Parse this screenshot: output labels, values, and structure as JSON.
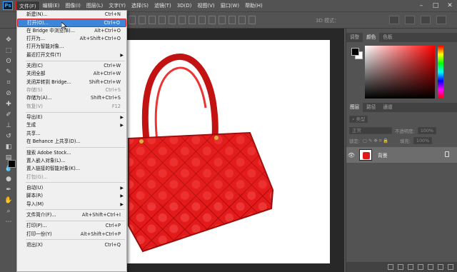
{
  "app": {
    "logo": "Ps"
  },
  "menubar": {
    "items": [
      "文件(F)",
      "编辑(E)",
      "图像(I)",
      "图层(L)",
      "文字(Y)",
      "选择(S)",
      "滤镜(T)",
      "3D(D)",
      "视图(V)",
      "窗口(W)",
      "帮助(H)"
    ],
    "active_index": 0
  },
  "options_bar": {
    "mode_label": "3D 模式："
  },
  "file_menu": {
    "groups": [
      [
        {
          "label": "新建(N)...",
          "shortcut": "Ctrl+N"
        },
        {
          "label": "打开(O)...",
          "shortcut": "Ctrl+O",
          "highlighted": true
        },
        {
          "label": "在 Bridge 中浏览(B)...",
          "shortcut": "Alt+Ctrl+O"
        },
        {
          "label": "打开为...",
          "shortcut": "Alt+Shift+Ctrl+O"
        },
        {
          "label": "打开为智能对象...",
          "shortcut": ""
        },
        {
          "label": "最近打开文件(T)",
          "shortcut": "",
          "submenu": true
        }
      ],
      [
        {
          "label": "关闭(C)",
          "shortcut": "Ctrl+W"
        },
        {
          "label": "关闭全部",
          "shortcut": "Alt+Ctrl+W"
        },
        {
          "label": "关闭并转到 Bridge...",
          "shortcut": "Shift+Ctrl+W"
        },
        {
          "label": "存储(S)",
          "shortcut": "Ctrl+S",
          "disabled": true
        },
        {
          "label": "存储为(A)...",
          "shortcut": "Shift+Ctrl+S"
        },
        {
          "label": "恢复(V)",
          "shortcut": "F12",
          "disabled": true
        }
      ],
      [
        {
          "label": "导出(E)",
          "shortcut": "",
          "submenu": true
        },
        {
          "label": "生成",
          "shortcut": "",
          "submenu": true
        },
        {
          "label": "共享...",
          "shortcut": ""
        },
        {
          "label": "在 Behance 上共享(D)...",
          "shortcut": ""
        }
      ],
      [
        {
          "label": "搜索 Adobe Stock...",
          "shortcut": ""
        },
        {
          "label": "置入嵌入对象(L)...",
          "shortcut": ""
        },
        {
          "label": "置入链接的智能对象(K)...",
          "shortcut": ""
        },
        {
          "label": "打包(G)...",
          "shortcut": "",
          "disabled": true
        }
      ],
      [
        {
          "label": "自动(U)",
          "shortcut": "",
          "submenu": true
        },
        {
          "label": "脚本(R)",
          "shortcut": "",
          "submenu": true
        },
        {
          "label": "导入(M)",
          "shortcut": "",
          "submenu": true
        }
      ],
      [
        {
          "label": "文件简介(F)...",
          "shortcut": "Alt+Shift+Ctrl+I"
        }
      ],
      [
        {
          "label": "打印(P)...",
          "shortcut": "Ctrl+P"
        },
        {
          "label": "打印一份(Y)",
          "shortcut": "Alt+Shift+Ctrl+P"
        }
      ],
      [
        {
          "label": "退出(X)",
          "shortcut": "Ctrl+Q"
        }
      ]
    ]
  },
  "color_panel": {
    "tabs": [
      "调整",
      "颜色",
      "色板"
    ],
    "active_tab": 1,
    "fg_color": "#000000",
    "bg_color": "#ffffff"
  },
  "layers_panel": {
    "tabs": [
      "图层",
      "路径",
      "通道"
    ],
    "active_tab": 0,
    "kind_filter": "类型",
    "blend_mode": "正常",
    "opacity_label": "不透明度:",
    "opacity_value": "100%",
    "lock_label": "锁定:",
    "fill_label": "填充:",
    "fill_value": "100%",
    "layers": [
      {
        "name": "背景",
        "visible": true,
        "locked": true
      }
    ]
  },
  "colors": {
    "accent_highlight": "#3c86d9",
    "callout_red": "#e02020",
    "bag_red": "#e01818"
  }
}
